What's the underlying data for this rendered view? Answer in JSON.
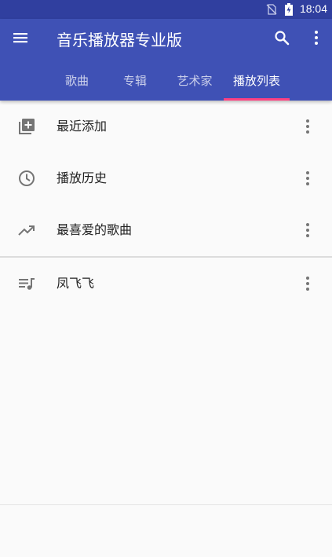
{
  "status_bar": {
    "time": "18:04"
  },
  "app_bar": {
    "title": "音乐播放器专业版"
  },
  "tabs": [
    {
      "label": "歌曲"
    },
    {
      "label": "专辑"
    },
    {
      "label": "艺术家"
    },
    {
      "label": "播放列表"
    }
  ],
  "active_tab": "播放列表",
  "playlists": {
    "smart": [
      {
        "label": "最近添加",
        "icon": "library-add-icon"
      },
      {
        "label": "播放历史",
        "icon": "clock-icon"
      },
      {
        "label": "最喜爱的歌曲",
        "icon": "trending-up-icon"
      }
    ],
    "user": [
      {
        "label": "凤飞飞",
        "icon": "queue-music-icon"
      }
    ]
  },
  "colors": {
    "primary": "#3f51b5",
    "primary_dark": "#303f9f",
    "accent": "#ff4081",
    "background": "#fafafa"
  }
}
